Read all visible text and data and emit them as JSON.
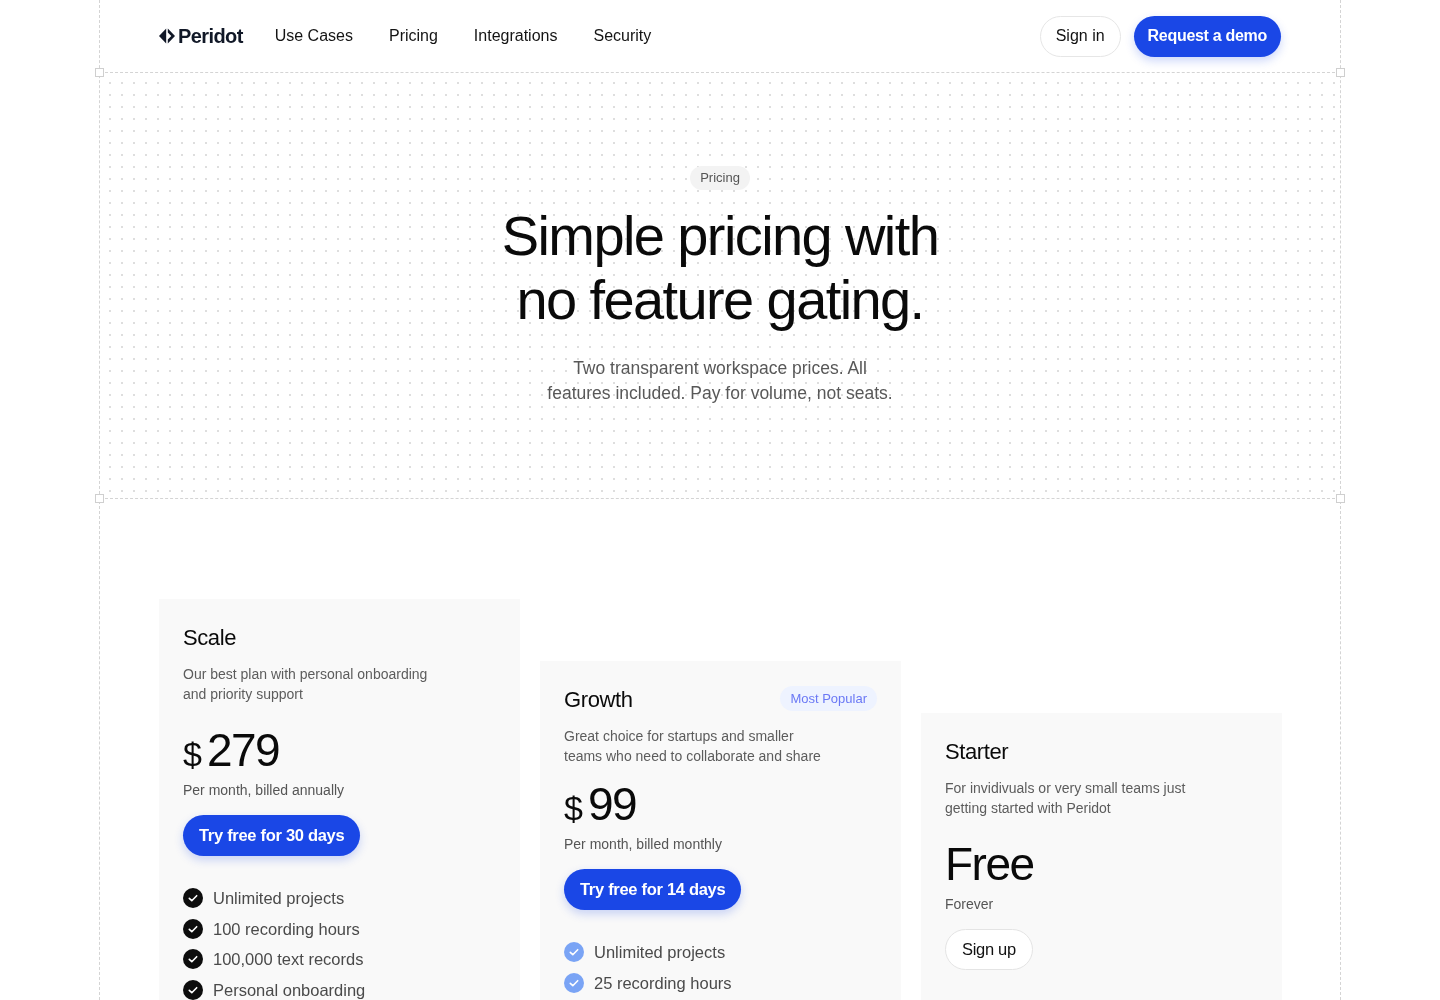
{
  "header": {
    "logo": "Peridot",
    "nav_links": [
      "Use Cases",
      "Pricing",
      "Integrations",
      "Security"
    ],
    "sign_in": "Sign in",
    "request_demo": "Request a demo"
  },
  "hero": {
    "tag": "Pricing",
    "heading": "Simple pricing with no feature gating.",
    "subtitle": "Two transparent workspace prices. All features included. Pay for volume, not seats."
  },
  "plans": [
    {
      "name": "Scale",
      "color": "#0d0d0d",
      "description": "Our best plan with personal onboarding and priority support",
      "currency": "$",
      "amount": "279",
      "billing": "Per month, billed annually",
      "button": {
        "label": "Try free for 30 days",
        "kind": "primary"
      },
      "features": [
        "Unlimited projects",
        "100 recording hours",
        "100,000 text records",
        "Personal onboarding"
      ]
    },
    {
      "name": "Growth",
      "color": "#7aa4f5",
      "badge": "Most Popular",
      "description": "Great choice for startups and smaller teams who need to collaborate and share",
      "currency": "$",
      "amount": "99",
      "billing": "Per month, billed monthly",
      "button": {
        "label": "Try free for 14 days",
        "kind": "primary"
      },
      "features": [
        "Unlimited projects",
        "25 recording hours"
      ]
    },
    {
      "name": "Starter",
      "description": "For invidivuals or very small teams just getting started with Peridot",
      "amount": "Free",
      "billing": "Forever",
      "button": {
        "label": "Sign up",
        "kind": "outline"
      }
    }
  ]
}
